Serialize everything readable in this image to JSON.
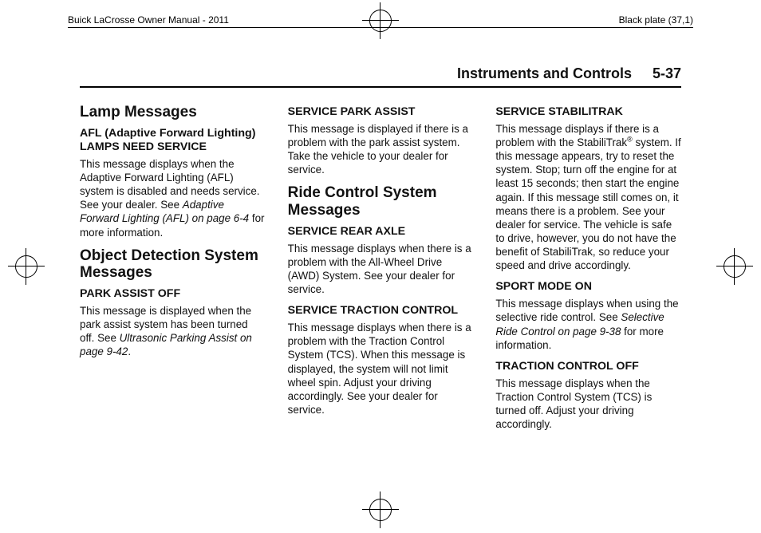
{
  "meta": {
    "manual_title": "Buick LaCrosse Owner Manual - 2011",
    "plate": "Black plate (37,1)"
  },
  "header": {
    "chapter": "Instruments and Controls",
    "page": "5-37"
  },
  "col1": {
    "sec1": {
      "title": "Lamp Messages",
      "msg1_title": "AFL (Adaptive Forward Lighting) LAMPS NEED SERVICE",
      "msg1_body_a": "This message displays when the Adaptive Forward Lighting (AFL) system is disabled and needs service. See your dealer. See ",
      "msg1_body_ital": "Adaptive Forward Lighting (AFL) on page 6-4",
      "msg1_body_b": " for more information."
    },
    "sec2": {
      "title": "Object Detection System Messages",
      "msg1_title": "PARK ASSIST OFF",
      "msg1_body_a": "This message is displayed when the park assist system has been turned off. See ",
      "msg1_body_ital": "Ultrasonic Parking Assist on page 9-42",
      "msg1_body_b": "."
    }
  },
  "col2": {
    "msg0_title": "SERVICE PARK ASSIST",
    "msg0_body": "This message is displayed if there is a problem with the park assist system. Take the vehicle to your dealer for service.",
    "sec1": {
      "title": "Ride Control System Messages",
      "msg1_title": "SERVICE REAR AXLE",
      "msg1_body": "This message displays when there is a problem with the All-Wheel Drive (AWD) System. See your dealer for service.",
      "msg2_title": "SERVICE TRACTION CONTROL",
      "msg2_body": "This message displays when there is a problem with the Traction Control System (TCS). When this message is displayed, the system will not limit wheel spin. Adjust your driving accordingly. See your dealer for service."
    }
  },
  "col3": {
    "msg1_title": "SERVICE STABILITRAK",
    "msg1_body_a": "This message displays if there is a problem with the StabiliTrak",
    "msg1_sup": "®",
    "msg1_body_b": " system. If this message appears, try to reset the system. Stop; turn off the engine for at least 15 seconds; then start the engine again. If this message still comes on, it means there is a problem. See your dealer for service. The vehicle is safe to drive, however, you do not have the benefit of StabiliTrak, so reduce your speed and drive accordingly.",
    "msg2_title": "SPORT MODE ON",
    "msg2_body_a": "This message displays when using the selective ride control. See ",
    "msg2_body_ital": "Selective Ride Control on page 9-38",
    "msg2_body_b": " for more information.",
    "msg3_title": "TRACTION CONTROL OFF",
    "msg3_body": "This message displays when the Traction Control System (TCS) is turned off. Adjust your driving accordingly."
  }
}
